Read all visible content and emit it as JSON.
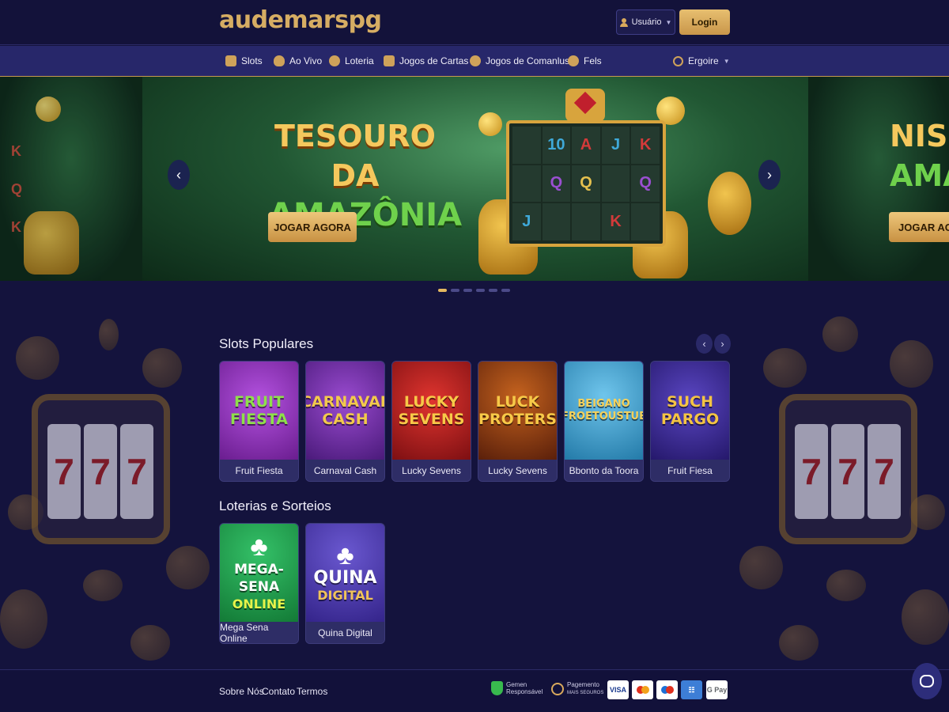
{
  "header": {
    "logo": "audemarspg",
    "user_label": "Usuário",
    "login_label": "Login"
  },
  "nav": {
    "items": [
      {
        "label": "Slots",
        "icon": "slot-machine-icon"
      },
      {
        "label": "Ao Vivo",
        "icon": "money-bag-icon"
      },
      {
        "label": "Loteria",
        "icon": "lottery-ball-icon"
      },
      {
        "label": "Jogos de Cartas",
        "icon": "cards-icon"
      },
      {
        "label": "Jogos de Comanlus",
        "icon": "spade-icon"
      },
      {
        "label": "Fels",
        "icon": "trophy-icon"
      }
    ],
    "language": "Ergoire"
  },
  "banner": {
    "title_line1": "TESOURO DA",
    "title_line2": "AMAZÔNIA",
    "cta": "JOGAR AGORA",
    "reel_symbols": [
      "",
      "10",
      "A",
      "J",
      "K",
      "",
      "Q",
      "Q",
      "",
      "Q",
      "J",
      "",
      "",
      "K",
      ""
    ],
    "side_left_letters": [
      "K",
      "Q",
      "K"
    ],
    "next_title_line1": "NISO",
    "next_title_line2": "AMA",
    "next_cta": "JOGAR AG",
    "slide_count": 6,
    "active_slide": 0
  },
  "slots_section": {
    "title": "Slots Populares",
    "games": [
      {
        "thumb_text": "FRUIT FIESTA",
        "label": "Fruit Fiesta",
        "bg": "#8e2ab8",
        "text_color": "#8ee04a"
      },
      {
        "thumb_text": "CARNAVAL CASH",
        "label": "Carnaval Cash",
        "bg": "#6a2aa0",
        "text_color": "#f2c94c"
      },
      {
        "thumb_text": "LUCKY SEVENS",
        "label": "Lucky Sevens",
        "bg": "#b3191e",
        "text_color": "#f7c948"
      },
      {
        "thumb_text": "LUCK PROTERS",
        "label": "Lucky Sevens",
        "bg": "#8a3a12",
        "text_color": "#f7c948"
      },
      {
        "thumb_text": "BEIGANO FROETOUSTUE",
        "label": "Bbonto da Toora",
        "bg": "#2f8fc8",
        "text_color": "#f6d15a"
      },
      {
        "thumb_text": "SUCH PARGO",
        "label": "Fruit Fiesa",
        "bg": "#3a2a8a",
        "text_color": "#f4c443"
      }
    ]
  },
  "lottery_section": {
    "title": "Loterias e Sorteios",
    "games": [
      {
        "thumb_line1": "MEGA-SENA",
        "thumb_line2": "ONLINE",
        "label": "Mega Sena Online",
        "bg": "#1f9e4a",
        "line2_color": "#e6f34a"
      },
      {
        "thumb_line1": "QUINA",
        "thumb_line2": "DIGITAL",
        "label": "Quina Digital",
        "bg": "#4a3aa8",
        "line2_color": "#f0c35a"
      }
    ]
  },
  "footer": {
    "links": [
      "Sobre Nós",
      "Contato",
      "Termos"
    ],
    "badge1_line1": "Gemen",
    "badge1_line2": "Responsável",
    "badge2_line1": "Pagemento",
    "badge2_line2": "MAIS SEGUROS",
    "payments": [
      {
        "label": "VISA",
        "color": "#1a3a8f"
      },
      {
        "label": "MC",
        "color": "#e0301e"
      },
      {
        "label": "MC",
        "color": "#1c6fd6"
      },
      {
        "label": "PIX",
        "color": "#1a5aa8"
      },
      {
        "label": "G Pay",
        "color": "#5f6368"
      }
    ]
  },
  "colors": {
    "background": "#14133d",
    "gold_accent": "#d6ad63",
    "nav_bar": "#27276a"
  }
}
